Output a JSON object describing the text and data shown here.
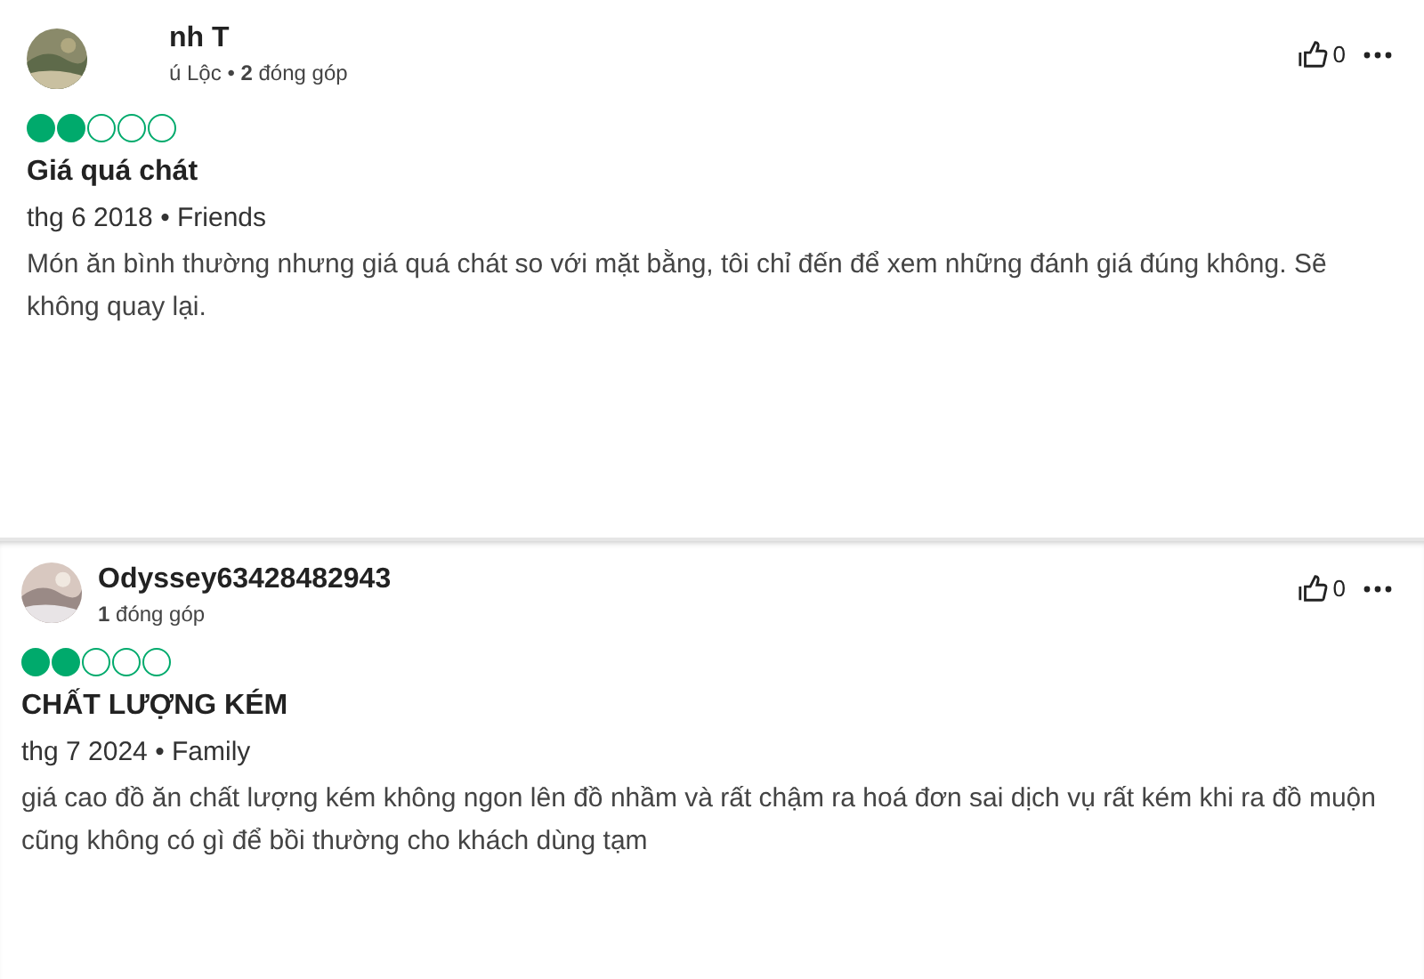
{
  "reviews": [
    {
      "author": "nh T",
      "meta": "ú Lộc • **2** đóng góp",
      "likes": "0",
      "stars": 2,
      "title": "Giá quá chát",
      "date": "thg 6 2018 • Friends",
      "body": "Món ăn bình thường nhưng giá quá chát so với mặt bằng, tôi chỉ đến để xem những đánh giá đúng không. Sẽ không quay lại."
    },
    {
      "author": "Odyssey63428482943",
      "meta": "**1** đóng góp",
      "likes": "0",
      "stars": 2,
      "title": "CHẤT LƯỢNG KÉM",
      "date": "thg 7 2024 • Family",
      "body": "giá cao đồ ăn chất lượng kém không ngon lên đồ nhầm và rất chậm ra hoá đơn sai dịch vụ rất kém khi ra đồ muộn cũng không có gì để bồi thường cho khách dùng tạm"
    }
  ]
}
